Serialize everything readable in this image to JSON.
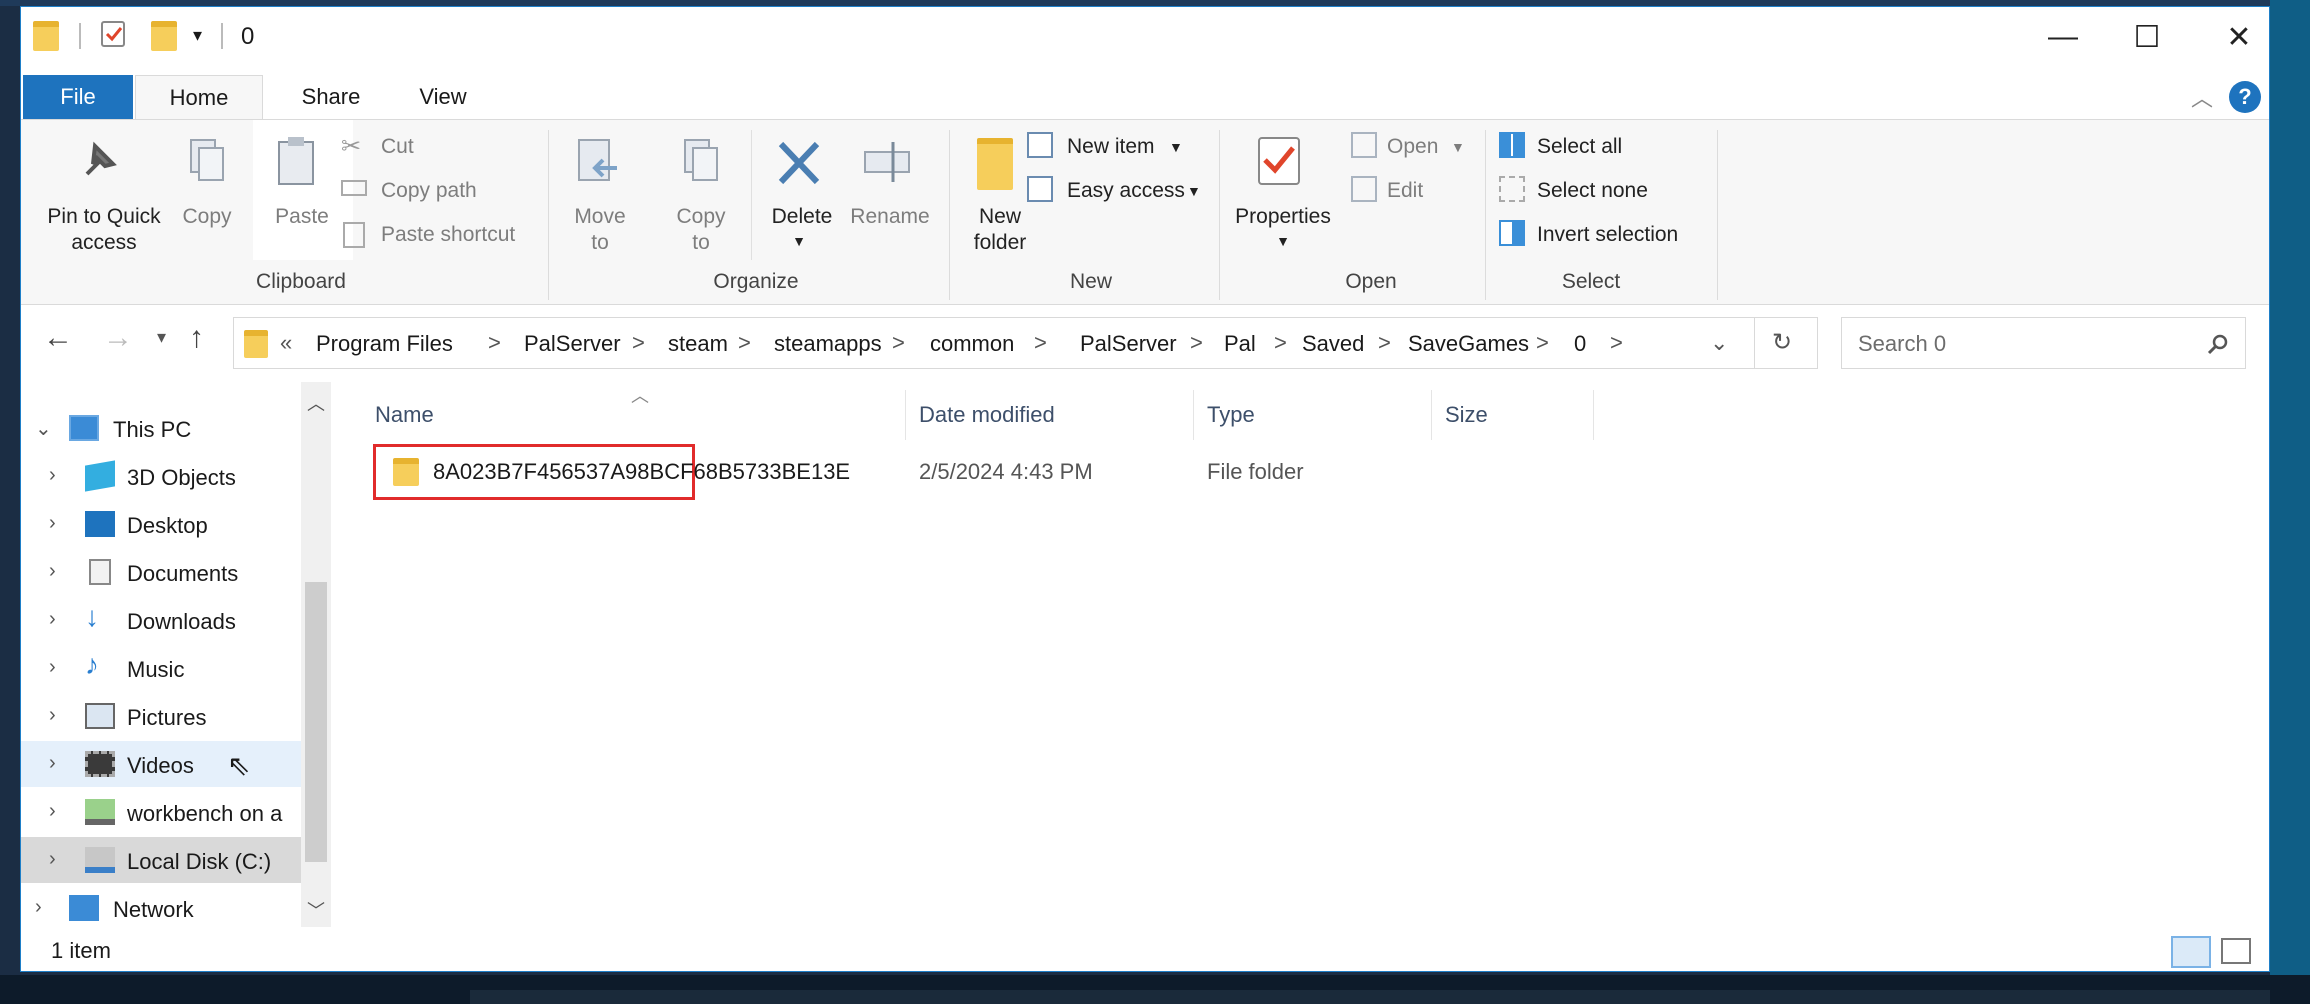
{
  "window": {
    "title": "0"
  },
  "window_controls": {
    "minimize": "—",
    "maximize": "☐",
    "close": "✕"
  },
  "tabs": [
    {
      "label": "File"
    },
    {
      "label": "Home"
    },
    {
      "label": "Share"
    },
    {
      "label": "View"
    }
  ],
  "ribbon": {
    "clipboard": {
      "pin_label": "Pin to Quick access",
      "pin_line1": "Pin to Quick",
      "pin_line2": "access",
      "copy": "Copy",
      "paste": "Paste",
      "cut": "Cut",
      "copy_path": "Copy path",
      "paste_shortcut": "Paste shortcut",
      "group": "Clipboard"
    },
    "organize": {
      "move_to_1": "Move",
      "move_to_2": "to",
      "copy_to_1": "Copy",
      "copy_to_2": "to",
      "delete": "Delete",
      "rename": "Rename",
      "group": "Organize"
    },
    "new": {
      "new_folder_1": "New",
      "new_folder_2": "folder",
      "new_item": "New item",
      "easy_access": "Easy access",
      "group": "New"
    },
    "open": {
      "properties": "Properties",
      "open": "Open",
      "edit": "Edit",
      "group": "Open"
    },
    "select": {
      "select_all": "Select all",
      "select_none": "Select none",
      "invert": "Invert selection",
      "group": "Select"
    }
  },
  "address": {
    "overflow": "«",
    "crumbs": [
      "Program Files",
      "PalServer",
      "steam",
      "steamapps",
      "common",
      "PalServer",
      "Pal",
      "Saved",
      "SaveGames",
      "0"
    ],
    "separator": ">"
  },
  "search": {
    "placeholder": "Search 0"
  },
  "nav": {
    "items": [
      {
        "label": "This PC",
        "icon": "computer-icon"
      },
      {
        "label": "3D Objects",
        "icon": "cube-icon"
      },
      {
        "label": "Desktop",
        "icon": "desktop-icon"
      },
      {
        "label": "Documents",
        "icon": "document-icon"
      },
      {
        "label": "Downloads",
        "icon": "download-icon"
      },
      {
        "label": "Music",
        "icon": "music-icon"
      },
      {
        "label": "Pictures",
        "icon": "picture-icon"
      },
      {
        "label": "Videos",
        "icon": "video-icon"
      },
      {
        "label": "workbench on a",
        "icon": "network-drive-icon"
      },
      {
        "label": "Local Disk (C:)",
        "icon": "disk-icon"
      },
      {
        "label": "Network",
        "icon": "network-icon"
      }
    ]
  },
  "columns": {
    "name": "Name",
    "date": "Date modified",
    "type": "Type",
    "size": "Size"
  },
  "files": [
    {
      "name": "8A023B7F456537A98BCF68B5733BE13E",
      "date": "2/5/2024 4:43 PM",
      "type": "File folder",
      "size": ""
    }
  ],
  "status": {
    "count": "1 item"
  },
  "colors": {
    "accent": "#1e73be",
    "highlight_box": "#e12b2b",
    "folder": "#f6ce5b"
  }
}
